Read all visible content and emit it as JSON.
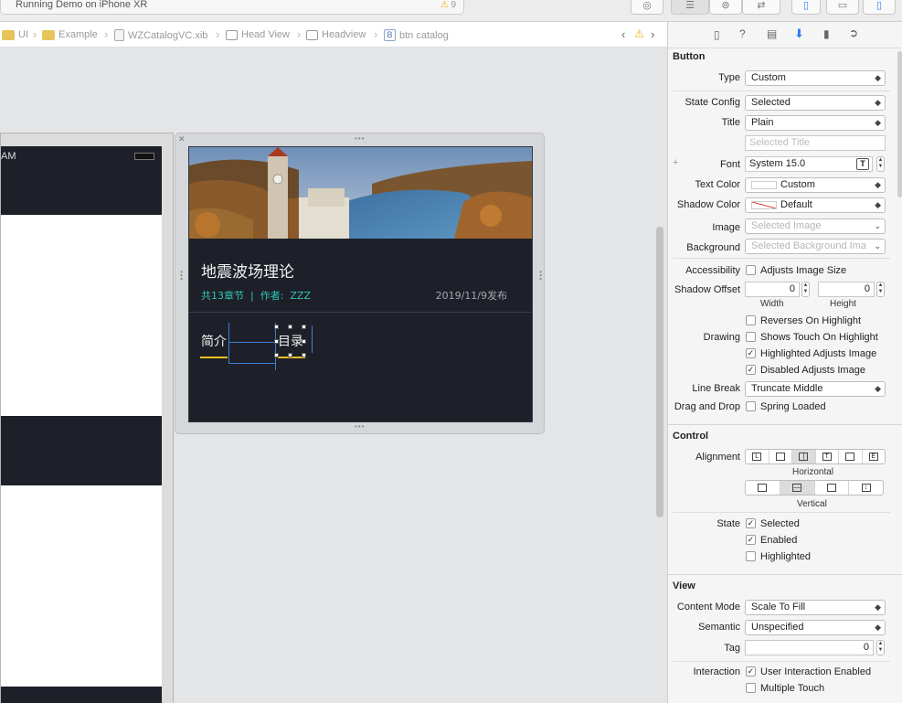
{
  "toolbar": {
    "run_status": "Running Demo on iPhone XR",
    "warning_count": "9"
  },
  "breadcrumb": [
    "UI",
    "Example",
    "WZCatalogVC.xib",
    "Head View",
    "Headview",
    "btn catalog"
  ],
  "cell": {
    "title": "地震波场理论",
    "meta": "共13章节  |  作者:  ZZZ",
    "date": "2019/11/9发布",
    "tab_intro": "简介",
    "tab_catalog": "目录"
  },
  "phone": {
    "status_time": "AM"
  },
  "inspector": {
    "button_section": "Button",
    "type_label": "Type",
    "type_value": "Custom",
    "state_config_label": "State Config",
    "state_config_value": "Selected",
    "title_label": "Title",
    "title_value": "Plain",
    "title_placeholder": "Selected Title",
    "font_label": "Font",
    "font_value": "System 15.0",
    "text_color_label": "Text Color",
    "text_color_value": "Custom",
    "shadow_color_label": "Shadow Color",
    "shadow_color_value": "Default",
    "image_label": "Image",
    "image_placeholder": "Selected Image",
    "background_label": "Background",
    "background_placeholder": "Selected Background Ima",
    "accessibility_label": "Accessibility",
    "adjusts_image_size": "Adjusts Image Size",
    "shadow_offset_label": "Shadow Offset",
    "shadow_offset_width": "0",
    "shadow_offset_height": "0",
    "width_label": "Width",
    "height_label": "Height",
    "drawing_label": "Drawing",
    "reverses_on_highlight": "Reverses On Highlight",
    "shows_touch_on_highlight": "Shows Touch On Highlight",
    "highlighted_adjusts_image": "Highlighted Adjusts Image",
    "disabled_adjusts_image": "Disabled Adjusts Image",
    "line_break_label": "Line Break",
    "line_break_value": "Truncate Middle",
    "drag_drop_label": "Drag and Drop",
    "spring_loaded": "Spring Loaded",
    "control_section": "Control",
    "alignment_label": "Alignment",
    "horizontal_label": "Horizontal",
    "vertical_label": "Vertical",
    "state_label": "State",
    "state_selected": "Selected",
    "state_enabled": "Enabled",
    "state_highlighted": "Highlighted",
    "view_section": "View",
    "content_mode_label": "Content Mode",
    "content_mode_value": "Scale To Fill",
    "semantic_label": "Semantic",
    "semantic_value": "Unspecified",
    "tag_label": "Tag",
    "tag_value": "0",
    "interaction_label": "Interaction",
    "user_interaction_enabled": "User Interaction Enabled",
    "multiple_touch": "Multiple Touch",
    "checks": {
      "adjusts_image_size": false,
      "reverses_on_highlight": false,
      "shows_touch_on_highlight": false,
      "highlighted_adjusts_image": true,
      "disabled_adjusts_image": true,
      "spring_loaded": false,
      "state_selected": true,
      "state_enabled": true,
      "state_highlighted": false,
      "user_interaction_enabled": true,
      "multiple_touch": false
    }
  },
  "colors": {
    "accent": "#2f7ff7",
    "cell_bg": "#1d2028",
    "meta_teal": "#31c4b6",
    "underline_yellow": "#f2c020"
  }
}
